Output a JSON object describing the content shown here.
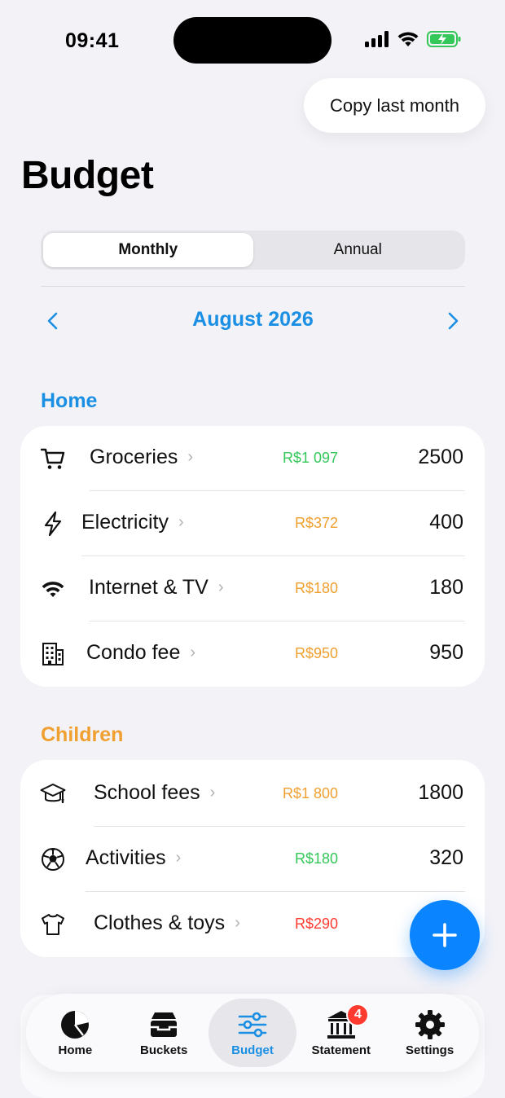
{
  "status": {
    "time": "09:41"
  },
  "header": {
    "copy_button": "Copy last month",
    "title": "Budget"
  },
  "period_toggle": {
    "options": [
      "Monthly",
      "Annual"
    ],
    "selected": "Monthly"
  },
  "month_nav": {
    "label": "August 2026"
  },
  "colors": {
    "accent": "#1a8fe3",
    "green": "#34c759",
    "orange": "#f0a030",
    "red": "#ff3b30",
    "home_section": "#1a8fe3",
    "children_section": "#f0a030"
  },
  "sections": [
    {
      "title": "Home",
      "items": [
        {
          "icon": "cart-icon",
          "label": "Groceries",
          "spent": "R$1 097",
          "spent_status": "green",
          "amount": "2500"
        },
        {
          "icon": "bolt-icon",
          "label": "Electricity",
          "spent": "R$372",
          "spent_status": "orange",
          "amount": "400"
        },
        {
          "icon": "wifi-icon",
          "label": "Internet & TV",
          "spent": "R$180",
          "spent_status": "orange",
          "amount": "180"
        },
        {
          "icon": "building-icon",
          "label": "Condo fee",
          "spent": "R$950",
          "spent_status": "orange",
          "amount": "950"
        }
      ]
    },
    {
      "title": "Children",
      "items": [
        {
          "icon": "graduation-cap-icon",
          "label": "School fees",
          "spent": "R$1 800",
          "spent_status": "orange",
          "amount": "1800"
        },
        {
          "icon": "soccer-ball-icon",
          "label": "Activities",
          "spent": "R$180",
          "spent_status": "green",
          "amount": "320"
        },
        {
          "icon": "tshirt-icon",
          "label": "Clothes & toys",
          "spent": "R$290",
          "spent_status": "red",
          "amount": ""
        }
      ]
    }
  ],
  "tabbar": {
    "tabs": [
      {
        "label": "Home",
        "icon": "pie-chart-icon"
      },
      {
        "label": "Buckets",
        "icon": "tray-icon"
      },
      {
        "label": "Budget",
        "icon": "sliders-icon",
        "active": true
      },
      {
        "label": "Statement",
        "icon": "bank-icon",
        "badge": "4"
      },
      {
        "label": "Settings",
        "icon": "gear-icon"
      }
    ]
  }
}
